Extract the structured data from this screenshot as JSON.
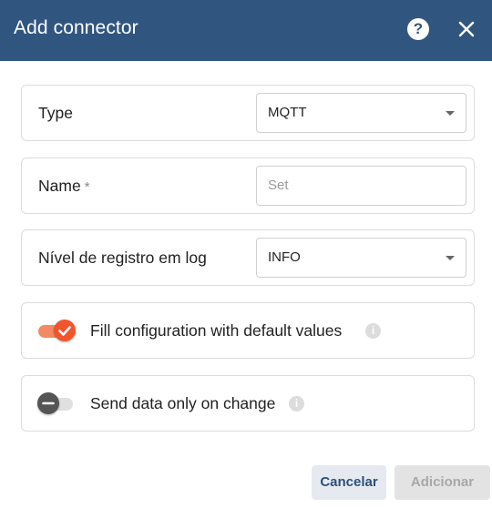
{
  "dialog": {
    "title": "Add connector",
    "help_icon": "help-icon",
    "close_icon": "close-icon",
    "help_glyph": "?"
  },
  "form": {
    "type": {
      "label": "Type",
      "value": "MQTT"
    },
    "name": {
      "label": "Name",
      "required_mark": "*",
      "placeholder": "Set"
    },
    "log_level": {
      "label": "Nível de registro em log",
      "value": "INFO"
    },
    "fill_defaults": {
      "label": "Fill configuration with default values",
      "checked": true,
      "info": "i"
    },
    "send_on_change": {
      "label": "Send data only on change",
      "checked": false,
      "info": "i"
    }
  },
  "actions": {
    "cancel_label": "Cancelar",
    "add_label": "Adicionar"
  },
  "colors": {
    "header": "#305680",
    "accent": "#f0552c",
    "primary_text": "#2d4f79"
  }
}
